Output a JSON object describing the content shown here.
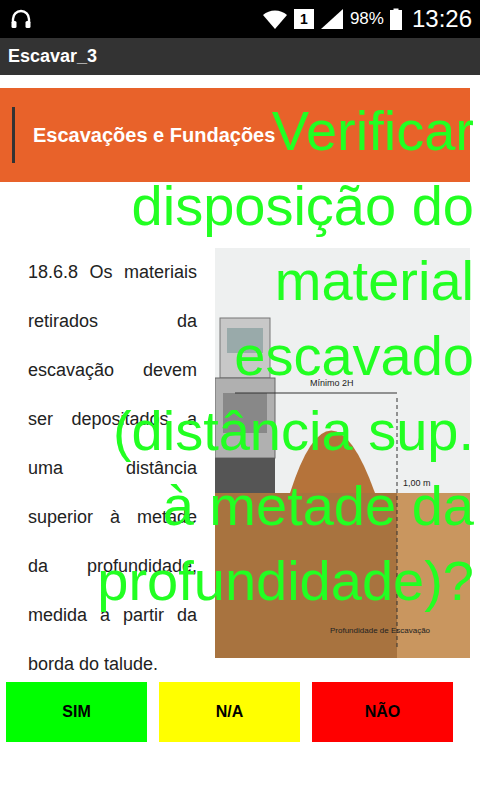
{
  "status_bar": {
    "sim": "1",
    "battery": "98%",
    "battery_level": 0.98,
    "time": "13:26"
  },
  "app_bar": {
    "title": "Escavar_3"
  },
  "slide": {
    "header": "Escavações e Fundações",
    "paragraph": "18.6.8 Os materiais retirados da escavação devem ser depositados a uma distância superior à metade da profundidade, medida a partir da borda do talude.",
    "diagram_labels": {
      "width": "Mínimo 2H",
      "height": "1,00 m",
      "depth": "Profundidade de Escavação"
    }
  },
  "question_lines": [
    "Verificar",
    "disposição do",
    "material",
    "escavado",
    "(distância sup.",
    "à metade da",
    "profundidade)?"
  ],
  "buttons": [
    {
      "label": "SIM",
      "color": "#00ff00"
    },
    {
      "label": "N/A",
      "color": "#ffff00"
    },
    {
      "label": "NÃO",
      "color": "#ff0000"
    }
  ]
}
